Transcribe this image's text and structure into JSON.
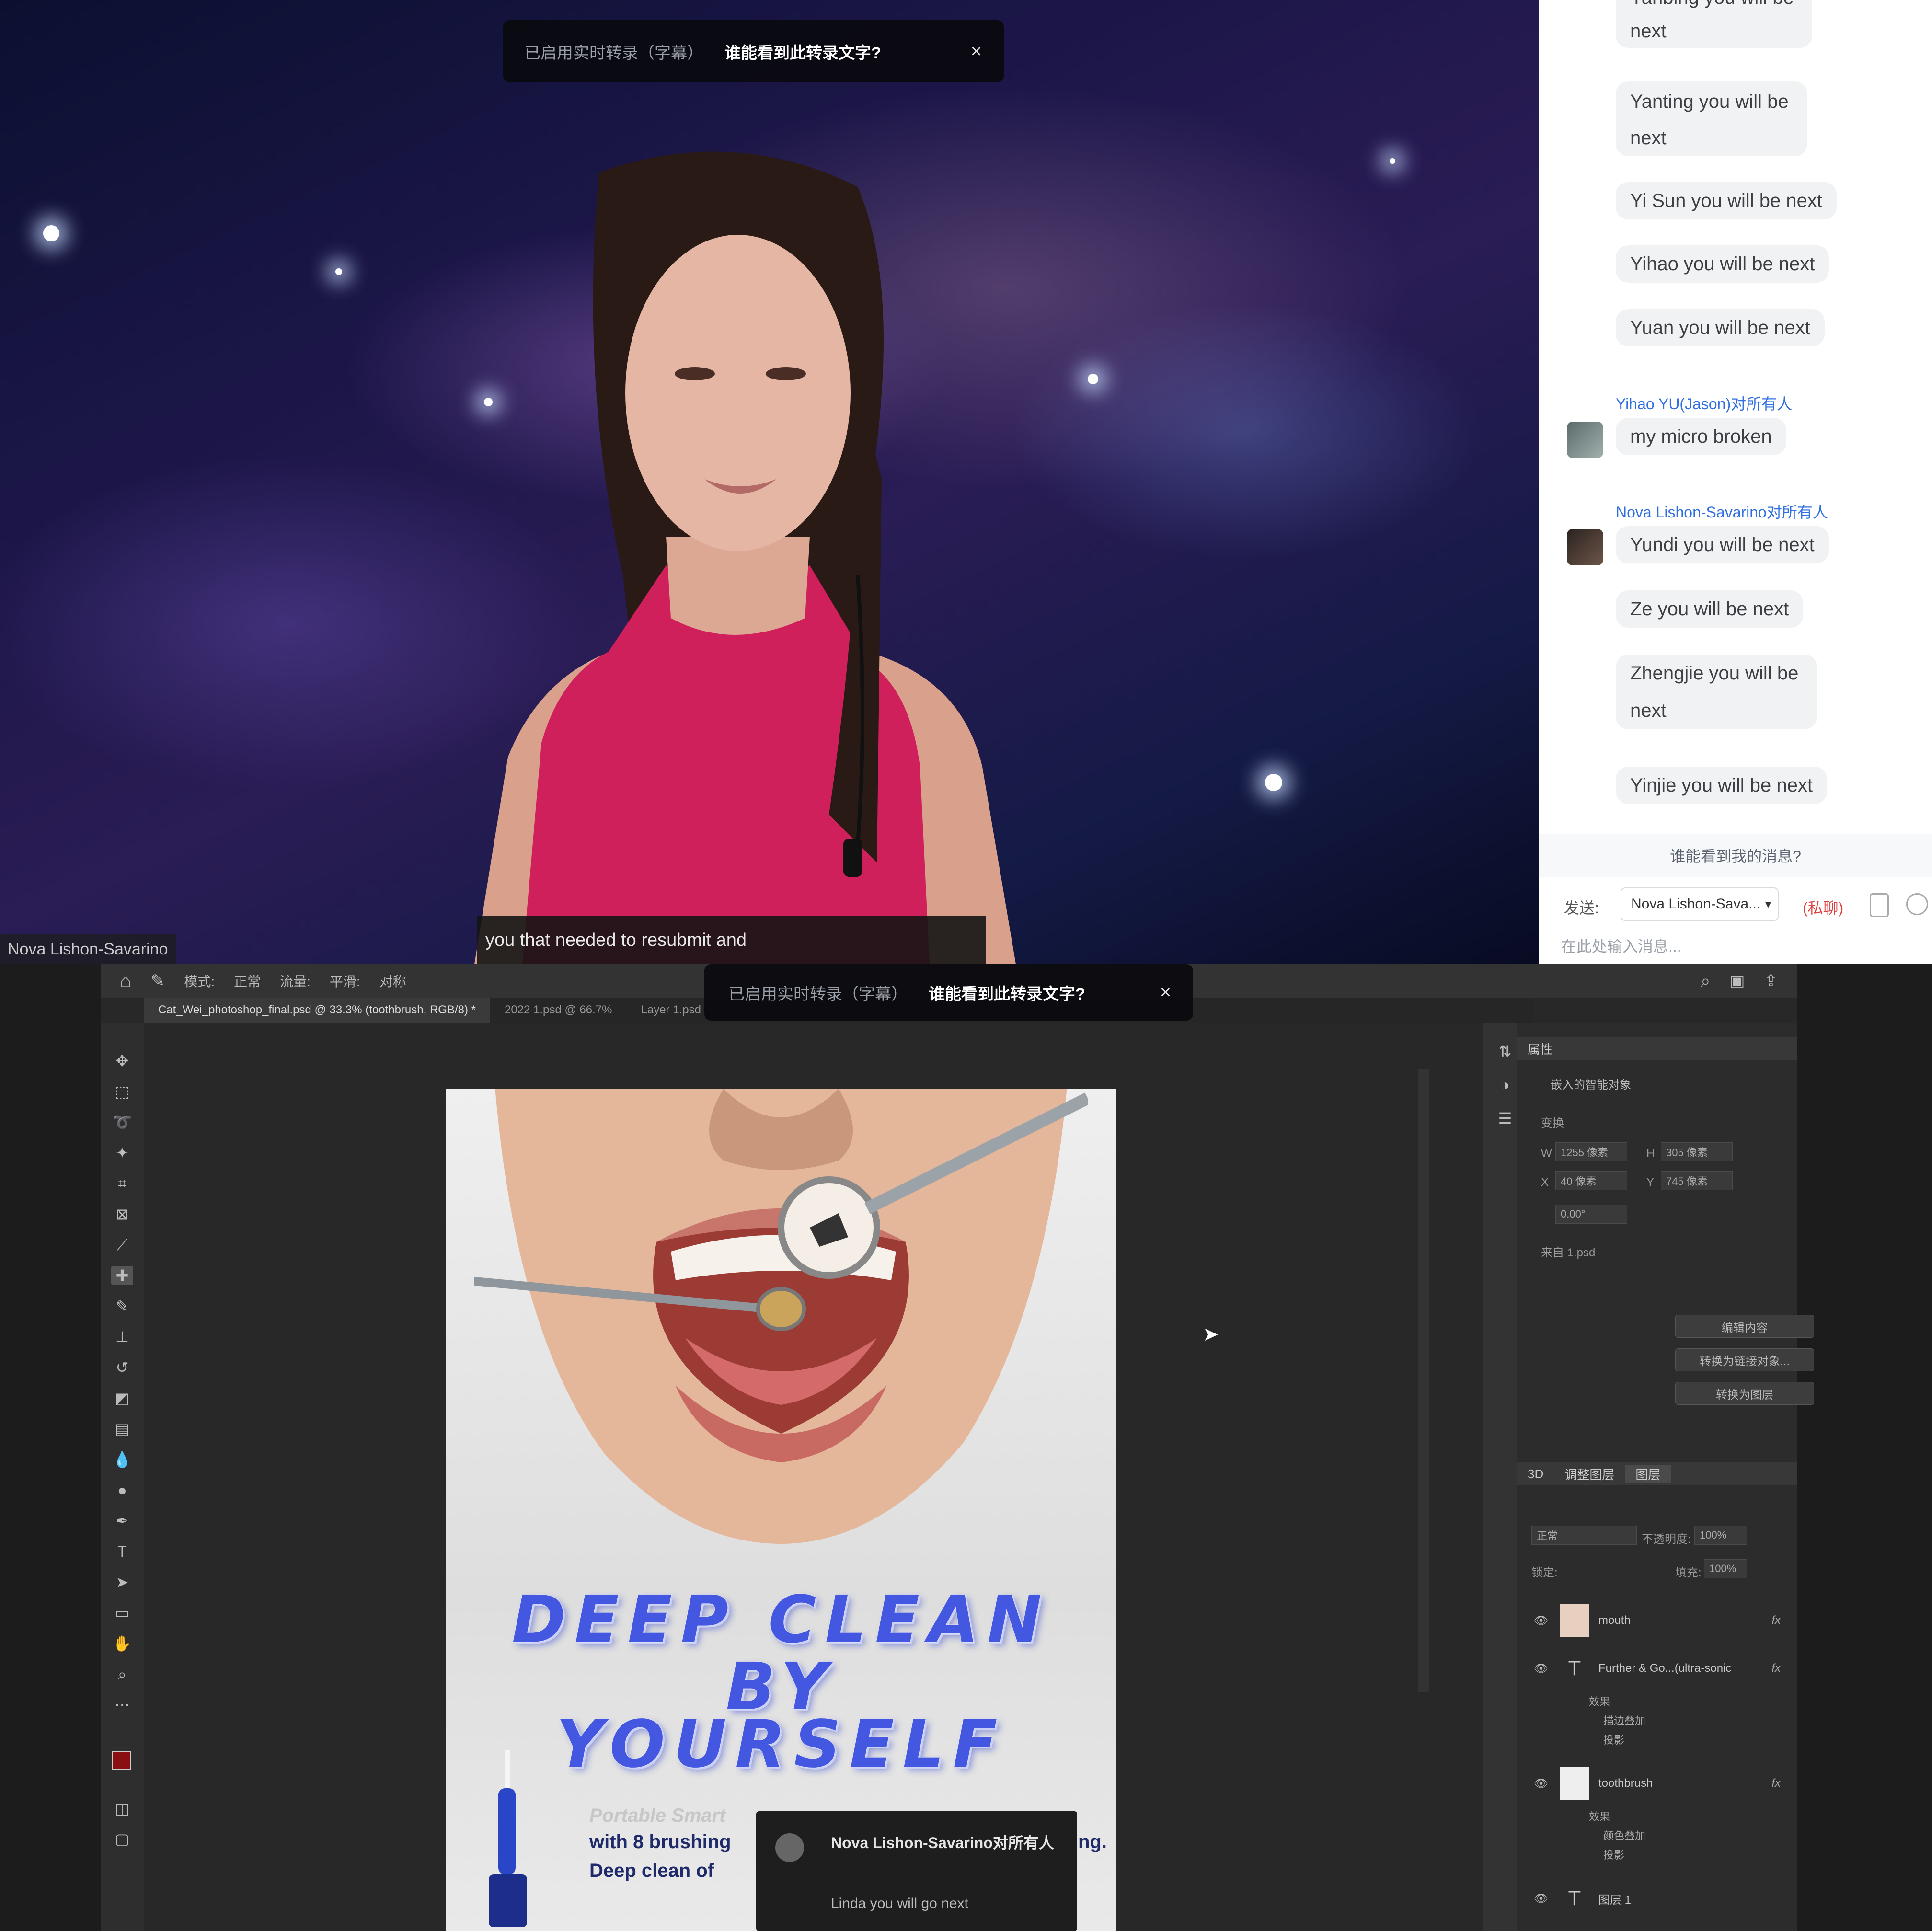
{
  "top_video": {
    "cc_banner": {
      "left": "已启用实时转录（字幕）",
      "right": "谁能看到此转录文字?",
      "close": "×"
    },
    "caption": "you that needed to resubmit and",
    "speaker_name": "Nova Lishon-Savarino"
  },
  "chat": {
    "messages_top": [
      {
        "text": "Yanbing you will be next"
      },
      {
        "text": "Yanting you will be next"
      },
      {
        "text": "Yi Sun you will be next"
      },
      {
        "text": "Yihao you will be next"
      },
      {
        "text": "Yuan you will be next"
      }
    ],
    "group1": {
      "sender": "Yihao YU(Jason)对所有人",
      "messages": [
        "my micro broken"
      ]
    },
    "group2": {
      "sender": "Nova Lishon-Savarino对所有人",
      "messages": [
        "Yundi you will be next",
        "Ze you will be next",
        "Zhengjie you will be next",
        "Yinjie you will be next"
      ]
    },
    "tip": "谁能看到我的消息?",
    "to_label": "发送:",
    "recipient": "Nova Lishon-Sava...",
    "private": "(私聊)",
    "input_placeholder": "在此处输入消息..."
  },
  "photoshop": {
    "cc_banner": {
      "left": "已启用实时转录（字幕）",
      "right": "谁能看到此转录文字?",
      "close": "×"
    },
    "options": [
      "模式:",
      "正常",
      "流量:",
      "平滑:",
      "对称"
    ],
    "tabs": [
      {
        "label": "Cat_Wei_photoshop_final.psd @ 33.3% (toothbrush, RGB/8) *",
        "active": true
      },
      {
        "label": "2022 1.psd @ 66.7%",
        "active": false
      },
      {
        "label": "Layer 1.psd",
        "active": false
      }
    ],
    "tools": [
      "move-tool",
      "marquee-tool",
      "lasso-tool",
      "magic-wand-tool",
      "crop-tool",
      "frame-tool",
      "eyedropper-tool",
      "healing-tool",
      "brush-tool",
      "stamp-tool",
      "history-brush-tool",
      "eraser-tool",
      "gradient-tool",
      "blur-tool",
      "dodge-tool",
      "pen-tool",
      "type-tool",
      "path-select-tool",
      "rectangle-tool",
      "hand-tool",
      "zoom-tool",
      "more-tools"
    ],
    "poster": {
      "headline": [
        "DEEP CLEAN",
        "BY",
        "YOURSELF"
      ],
      "sub1": "Portable Smart",
      "sub2": "with 8 brushing",
      "sub2_end": "ng.",
      "sub3": "Deep clean of"
    },
    "properties": {
      "tab": "属性",
      "kind": "嵌入的智能对象",
      "transform": "变换",
      "w_label": "W",
      "w": "1255 像素",
      "h_label": "H",
      "h": "305 像素",
      "x_label": "X",
      "x": "40 像素",
      "y_label": "Y",
      "y": "745 像素",
      "angle": "0.00°",
      "source": "来自 1.psd",
      "buttons": [
        "编辑内容",
        "转换为链接对象...",
        "转换为图层"
      ]
    },
    "layers": {
      "tabs": [
        "3D",
        "调整图层",
        "图层"
      ],
      "blend": "正常",
      "opacity_label": "不透明度:",
      "opacity": "100%",
      "lock_label": "锁定:",
      "fill_label": "填充:",
      "fill": "100%",
      "items": [
        {
          "name": "mouth",
          "type": "smart",
          "effects": []
        },
        {
          "name": "Further & Go...(ultra-sonic",
          "type": "text",
          "effects": [
            "效果",
            "描边叠加",
            "投影"
          ]
        },
        {
          "name": "toothbrush",
          "type": "smart",
          "effects": [
            "效果",
            "颜色叠加",
            "投影"
          ]
        },
        {
          "name": "图层 1",
          "type": "text",
          "effects": []
        }
      ]
    }
  },
  "notification": {
    "from": "Nova Lishon-Savarino对所有人",
    "message": "Linda you will go next"
  }
}
